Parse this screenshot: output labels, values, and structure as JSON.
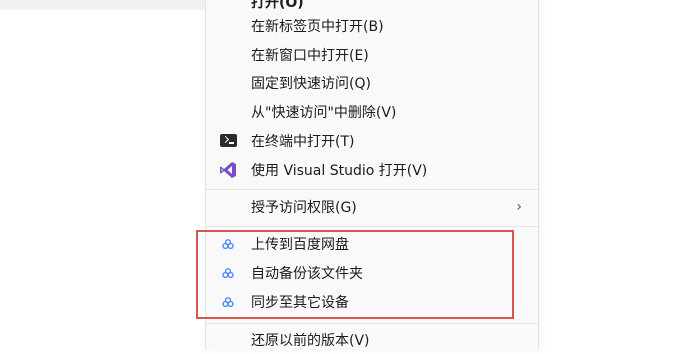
{
  "menu": {
    "items": [
      {
        "label": "打开(O)",
        "icon": null,
        "submenu": false
      },
      {
        "label": "在新标签页中打开(B)",
        "icon": null,
        "submenu": false
      },
      {
        "label": "在新窗口中打开(E)",
        "icon": null,
        "submenu": false
      },
      {
        "label": "固定到快速访问(Q)",
        "icon": null,
        "submenu": false
      },
      {
        "label": "从\"快速访问\"中删除(V)",
        "icon": null,
        "submenu": false
      },
      {
        "label": "在终端中打开(T)",
        "icon": "terminal-icon",
        "submenu": false
      },
      {
        "label": "使用 Visual Studio 打开(V)",
        "icon": "visual-studio-icon",
        "submenu": false
      },
      {
        "label": "授予访问权限(G)",
        "icon": null,
        "submenu": true
      },
      {
        "label": "上传到百度网盘",
        "icon": "baidu-netdisk-icon",
        "submenu": false
      },
      {
        "label": "自动备份该文件夹",
        "icon": "baidu-netdisk-icon",
        "submenu": false
      },
      {
        "label": "同步至其它设备",
        "icon": "baidu-netdisk-icon",
        "submenu": false
      },
      {
        "label": "还原以前的版本(V)",
        "icon": null,
        "submenu": false
      }
    ],
    "submenu_arrow": "›"
  },
  "colors": {
    "menu_bg": "#f9f9f9",
    "highlight_border": "#d9534f",
    "vs_purple": "#7b4cc8",
    "baidu_blue": "#4a8cff"
  }
}
